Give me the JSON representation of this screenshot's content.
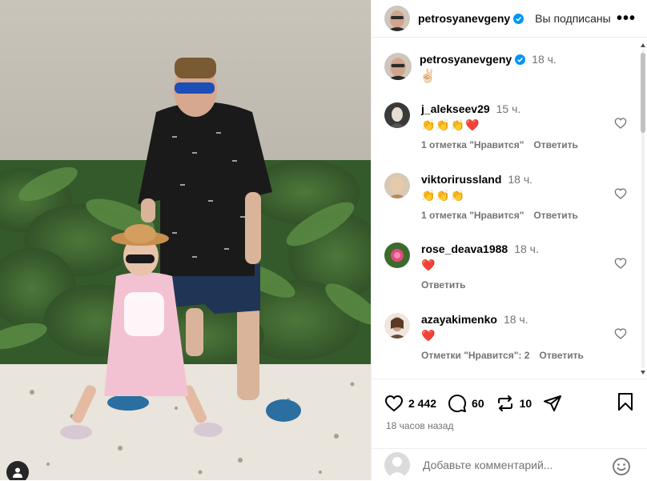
{
  "header": {
    "username": "petrosyanevgeny",
    "follow_state": "Вы подписаны",
    "more_label": "•••"
  },
  "caption": {
    "username": "petrosyanevgeny",
    "time": "18 ч.",
    "text": "✌🏻"
  },
  "comments": [
    {
      "username": "j_alekseev29",
      "time": "15 ч.",
      "text": "👏👏👏❤️",
      "likes": "1 отметка \"Нравится\"",
      "reply": "Ответить"
    },
    {
      "username": "viktorirussland",
      "time": "18 ч.",
      "text": "👏👏👏",
      "likes": "1 отметка \"Нравится\"",
      "reply": "Ответить"
    },
    {
      "username": "rose_deava1988",
      "time": "18 ч.",
      "text": "❤️",
      "likes": "",
      "reply": "Ответить"
    },
    {
      "username": "azayakimenko",
      "time": "18 ч.",
      "text": "❤️",
      "likes": "Отметки \"Нравится\": 2",
      "reply": "Ответить"
    }
  ],
  "actions": {
    "likes_count": "2 442",
    "comments_count": "60",
    "reposts_count": "10",
    "posted_ago": "18 часов назад"
  },
  "add_comment": {
    "placeholder": "Добавьте комментарий..."
  },
  "colors": {
    "verified_blue": "#0095f6",
    "secondary_text": "#737373",
    "heart_red": "#e0245e"
  },
  "icons": [
    "verified-icon",
    "heart-icon",
    "comment-icon",
    "repost-icon",
    "share-icon",
    "bookmark-icon",
    "emoji-icon",
    "user-tag-icon",
    "more-icon"
  ]
}
